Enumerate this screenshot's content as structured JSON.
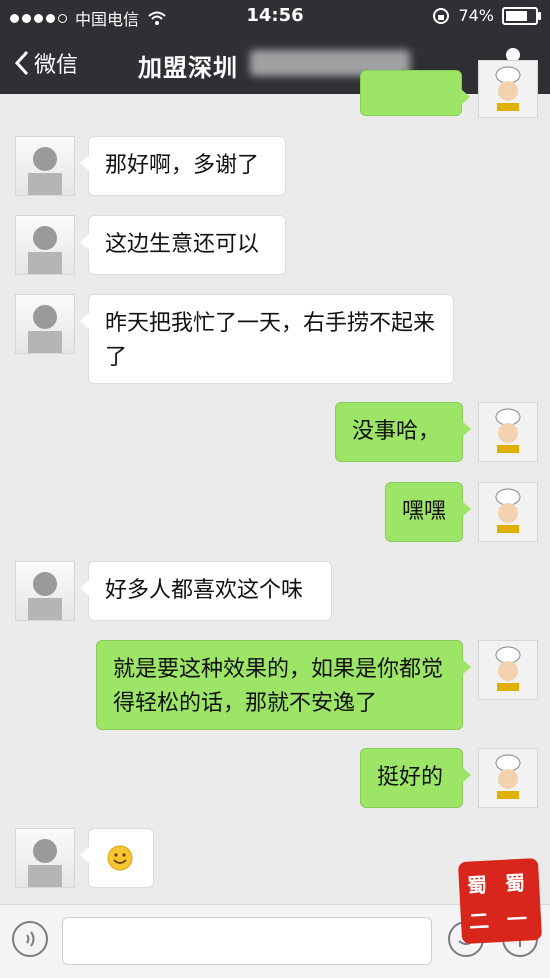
{
  "status_bar": {
    "carrier": "中国电信",
    "time": "14:56",
    "battery": "74%",
    "battery_level": 0.74
  },
  "nav": {
    "back_label": "微信",
    "title": "加盟深圳"
  },
  "messages": [
    {
      "side": "in",
      "text": "那好啊，多谢了"
    },
    {
      "side": "in",
      "text": "这边生意还可以"
    },
    {
      "side": "in",
      "text": "昨天把我忙了一天，右手捞不起来了"
    },
    {
      "side": "out",
      "text": "没事哈，"
    },
    {
      "side": "out",
      "text": "嘿嘿"
    },
    {
      "side": "in",
      "text": "好多人都喜欢这个味"
    },
    {
      "side": "out",
      "text": "就是要这种效果的，如果是你都觉得轻松的话，那就不安逸了"
    },
    {
      "side": "out",
      "text": "挺好的"
    },
    {
      "side": "in",
      "text": "",
      "emoji": "smile-emoji"
    }
  ],
  "stamp_text": [
    "蜀",
    "蜀",
    "二",
    "一"
  ],
  "colors": {
    "nav_bg": "#2e3034",
    "chat_bg": "#ebebeb",
    "out_bubble": "#9de566",
    "in_bubble": "#ffffff"
  }
}
